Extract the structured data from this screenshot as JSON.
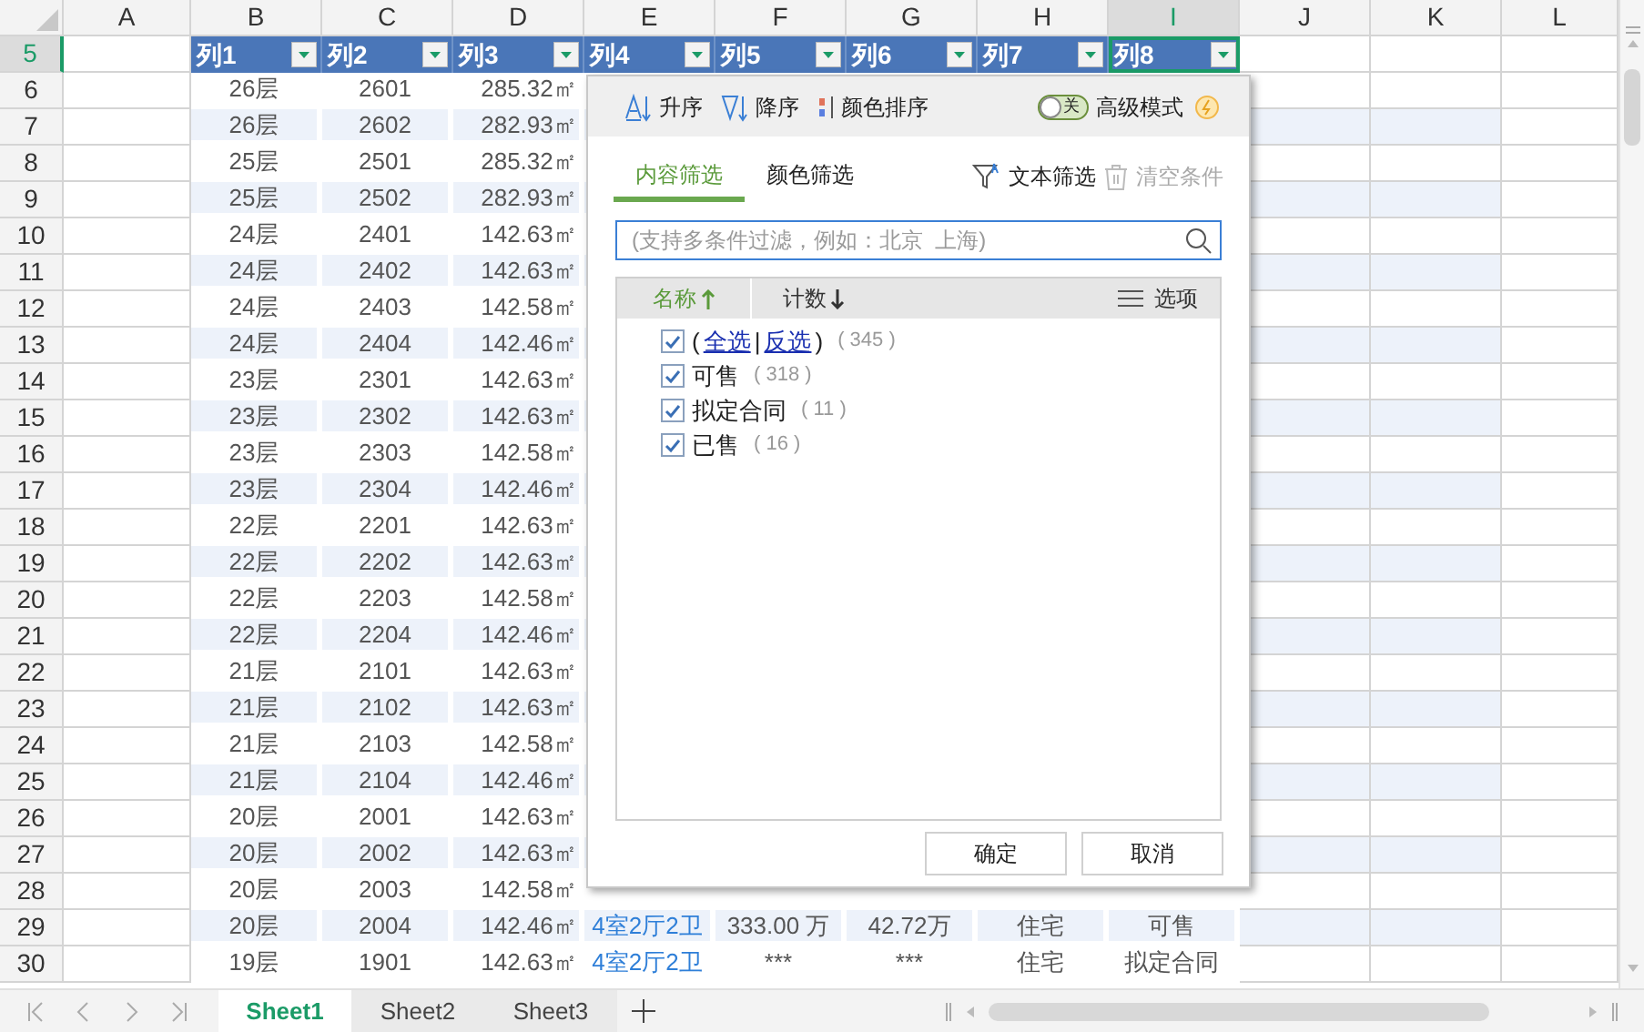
{
  "columns": [
    {
      "letter": "A",
      "selected": false
    },
    {
      "letter": "B",
      "selected": false
    },
    {
      "letter": "C",
      "selected": false
    },
    {
      "letter": "D",
      "selected": false
    },
    {
      "letter": "E",
      "selected": false
    },
    {
      "letter": "F",
      "selected": false
    },
    {
      "letter": "G",
      "selected": false
    },
    {
      "letter": "H",
      "selected": false
    },
    {
      "letter": "I",
      "selected": true
    },
    {
      "letter": "J",
      "selected": false
    },
    {
      "letter": "K",
      "selected": false
    },
    {
      "letter": "L",
      "selected": false
    }
  ],
  "header_row": {
    "number": "5",
    "selected": true,
    "labels": [
      "列1",
      "列2",
      "列3",
      "列4",
      "列5",
      "列6",
      "列7",
      "列8"
    ]
  },
  "rows": [
    {
      "number": "6",
      "selected": false,
      "cells": [
        "26层",
        "2601",
        "285.32㎡"
      ]
    },
    {
      "number": "7",
      "selected": false,
      "cells": [
        "26层",
        "2602",
        "282.93㎡"
      ]
    },
    {
      "number": "8",
      "selected": false,
      "cells": [
        "25层",
        "2501",
        "285.32㎡"
      ]
    },
    {
      "number": "9",
      "selected": false,
      "cells": [
        "25层",
        "2502",
        "282.93㎡"
      ]
    },
    {
      "number": "10",
      "selected": false,
      "cells": [
        "24层",
        "2401",
        "142.63㎡"
      ]
    },
    {
      "number": "11",
      "selected": false,
      "cells": [
        "24层",
        "2402",
        "142.63㎡"
      ]
    },
    {
      "number": "12",
      "selected": false,
      "cells": [
        "24层",
        "2403",
        "142.58㎡"
      ]
    },
    {
      "number": "13",
      "selected": false,
      "cells": [
        "24层",
        "2404",
        "142.46㎡"
      ]
    },
    {
      "number": "14",
      "selected": false,
      "cells": [
        "23层",
        "2301",
        "142.63㎡"
      ]
    },
    {
      "number": "15",
      "selected": false,
      "cells": [
        "23层",
        "2302",
        "142.63㎡"
      ]
    },
    {
      "number": "16",
      "selected": false,
      "cells": [
        "23层",
        "2303",
        "142.58㎡"
      ]
    },
    {
      "number": "17",
      "selected": false,
      "cells": [
        "23层",
        "2304",
        "142.46㎡"
      ]
    },
    {
      "number": "18",
      "selected": false,
      "cells": [
        "22层",
        "2201",
        "142.63㎡"
      ]
    },
    {
      "number": "19",
      "selected": false,
      "cells": [
        "22层",
        "2202",
        "142.63㎡"
      ]
    },
    {
      "number": "20",
      "selected": false,
      "cells": [
        "22层",
        "2203",
        "142.58㎡"
      ]
    },
    {
      "number": "21",
      "selected": false,
      "cells": [
        "22层",
        "2204",
        "142.46㎡"
      ]
    },
    {
      "number": "22",
      "selected": false,
      "cells": [
        "21层",
        "2101",
        "142.63㎡"
      ]
    },
    {
      "number": "23",
      "selected": false,
      "cells": [
        "21层",
        "2102",
        "142.63㎡"
      ]
    },
    {
      "number": "24",
      "selected": false,
      "cells": [
        "21层",
        "2103",
        "142.58㎡"
      ]
    },
    {
      "number": "25",
      "selected": false,
      "cells": [
        "21层",
        "2104",
        "142.46㎡"
      ]
    },
    {
      "number": "26",
      "selected": false,
      "cells": [
        "20层",
        "2001",
        "142.63㎡"
      ]
    },
    {
      "number": "27",
      "selected": false,
      "cells": [
        "20层",
        "2002",
        "142.63㎡"
      ]
    },
    {
      "number": "28",
      "selected": false,
      "cells": [
        "20层",
        "2003",
        "142.58㎡"
      ]
    },
    {
      "number": "29",
      "selected": false,
      "cells": [
        "20层",
        "2004",
        "142.46㎡",
        "4室2厅2卫",
        "333.00 万",
        "42.72万",
        "住宅",
        "可售"
      ]
    },
    {
      "number": "30",
      "selected": false,
      "cells": [
        "19层",
        "1901",
        "142.63㎡",
        "4室2厅2卫",
        "***",
        "***",
        "住宅",
        "拟定合同"
      ]
    }
  ],
  "filter_panel": {
    "sort_buttons": [
      "升序",
      "降序",
      "颜色排序"
    ],
    "advanced_mode": {
      "switch_label": "关",
      "on": false,
      "label": "高级模式"
    },
    "tabs": [
      {
        "label": "内容筛选",
        "selected": true
      },
      {
        "label": "颜色筛选",
        "selected": false
      }
    ],
    "text_filter": "文本筛选",
    "clear_conditions": {
      "label": "清空条件",
      "disabled": true
    },
    "search": {
      "placeholder": "(支持多条件过滤，例如：北京  上海)"
    },
    "list_header": {
      "name": "名称",
      "count": "计数",
      "options": "选项"
    },
    "items": [
      {
        "kind": "all",
        "checked": true,
        "parts": [
          {
            "text": "(",
            "link": false
          },
          {
            "text": "全选",
            "link": true
          },
          {
            "text": "|",
            "link": false
          },
          {
            "text": "反选",
            "link": true
          },
          {
            "text": ")",
            "link": false
          }
        ],
        "count": "( 345 )"
      },
      {
        "kind": "value",
        "checked": true,
        "label": "可售",
        "count": "( 318 )"
      },
      {
        "kind": "value",
        "checked": true,
        "label": "拟定合同",
        "count": "( 11 )"
      },
      {
        "kind": "value",
        "checked": true,
        "label": "已售",
        "count": "( 16 )"
      }
    ],
    "buttons": [
      "确定",
      "取消"
    ]
  },
  "sheet_tabs": [
    {
      "label": "Sheet1",
      "selected": true
    },
    {
      "label": "Sheet2",
      "selected": false
    },
    {
      "label": "Sheet3",
      "selected": false
    }
  ]
}
